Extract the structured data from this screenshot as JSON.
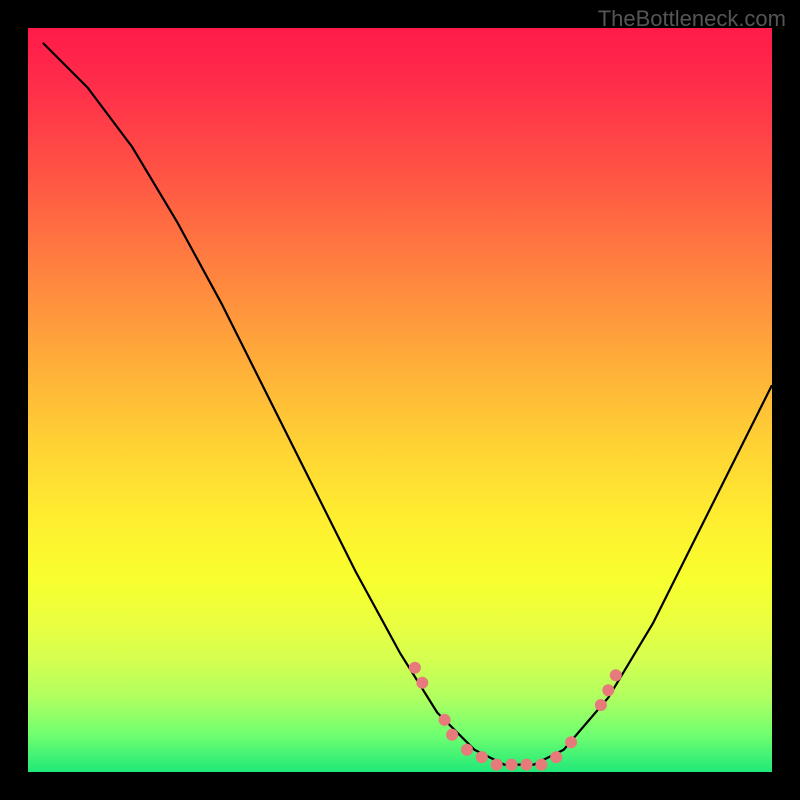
{
  "watermark": "TheBottleneck.com",
  "chart_data": {
    "type": "line",
    "title": "",
    "xlabel": "",
    "ylabel": "",
    "xlim": [
      0,
      100
    ],
    "ylim": [
      0,
      100
    ],
    "curve_description": "Asymmetric V-shaped curve on rainbow gradient (red top to green bottom). Left branch starts near top-left, descends steeply to a flat minimum around x≈62-70 near y≈0, then right branch rises more gently toward upper-right.",
    "curve": [
      {
        "x": 2,
        "y": 98
      },
      {
        "x": 8,
        "y": 92
      },
      {
        "x": 14,
        "y": 84
      },
      {
        "x": 20,
        "y": 74
      },
      {
        "x": 26,
        "y": 63
      },
      {
        "x": 32,
        "y": 51
      },
      {
        "x": 38,
        "y": 39
      },
      {
        "x": 44,
        "y": 27
      },
      {
        "x": 50,
        "y": 16
      },
      {
        "x": 55,
        "y": 8
      },
      {
        "x": 60,
        "y": 3
      },
      {
        "x": 64,
        "y": 1
      },
      {
        "x": 68,
        "y": 1
      },
      {
        "x": 72,
        "y": 3
      },
      {
        "x": 78,
        "y": 10
      },
      {
        "x": 84,
        "y": 20
      },
      {
        "x": 90,
        "y": 32
      },
      {
        "x": 96,
        "y": 44
      },
      {
        "x": 100,
        "y": 52
      }
    ],
    "points": [
      {
        "x": 52,
        "y": 14
      },
      {
        "x": 53,
        "y": 12
      },
      {
        "x": 56,
        "y": 7
      },
      {
        "x": 57,
        "y": 5
      },
      {
        "x": 59,
        "y": 3
      },
      {
        "x": 61,
        "y": 2
      },
      {
        "x": 63,
        "y": 1
      },
      {
        "x": 65,
        "y": 1
      },
      {
        "x": 67,
        "y": 1
      },
      {
        "x": 69,
        "y": 1
      },
      {
        "x": 71,
        "y": 2
      },
      {
        "x": 73,
        "y": 4
      },
      {
        "x": 77,
        "y": 9
      },
      {
        "x": 78,
        "y": 11
      },
      {
        "x": 79,
        "y": 13
      }
    ],
    "point_color": "#e77a7a",
    "point_radius": 6
  }
}
